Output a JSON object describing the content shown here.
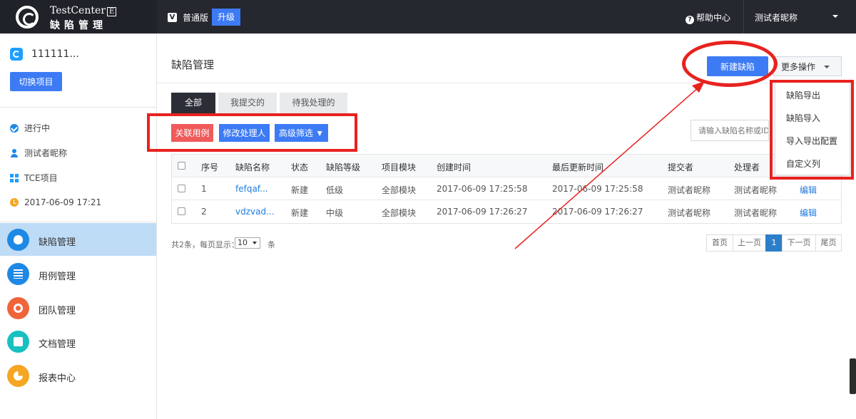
{
  "brand": {
    "line1": "TestCenter",
    "badge": "E",
    "line2": "缺陷管理"
  },
  "topbar": {
    "edition_icon": "V",
    "edition": "普通版",
    "upgrade": "升级",
    "help_icon": "?",
    "help": "帮助中心",
    "user": "测试者昵称"
  },
  "sidebar": {
    "project_name": "111111...",
    "switch_button": "切换项目",
    "info": [
      {
        "icon": "check-circle-icon",
        "text": "进行中"
      },
      {
        "icon": "user-icon",
        "text": "测试者昵称"
      },
      {
        "icon": "grid-icon",
        "text": "TCE项目"
      },
      {
        "icon": "clock-icon",
        "text": "2017-06-09 17:21"
      }
    ],
    "nav": [
      {
        "icon": "bug-icon",
        "label": "缺陷管理",
        "color": "#1e88e5",
        "active": true
      },
      {
        "icon": "list-icon",
        "label": "用例管理",
        "color": "#1e88e5",
        "active": false
      },
      {
        "icon": "team-icon",
        "label": "团队管理",
        "color": "#f0643c",
        "active": false
      },
      {
        "icon": "document-icon",
        "label": "文档管理",
        "color": "#18c0c0",
        "active": false
      },
      {
        "icon": "pie-chart-icon",
        "label": "报表中心",
        "color": "#f5a623",
        "active": false
      }
    ]
  },
  "main": {
    "title": "缺陷管理",
    "new_button": "新建缺陷",
    "more_button": "更多操作",
    "tabs": [
      "全部",
      "我提交的",
      "待我处理的"
    ],
    "actions": {
      "link_case": "关联用例",
      "change_handler": "修改处理人",
      "advanced_filter": "高级筛选 ▼"
    },
    "search_placeholder": "请输入缺陷名称或ID",
    "dropdown": [
      "缺陷导出",
      "缺陷导入",
      "导入导出配置",
      "自定义列"
    ],
    "table": {
      "headers": [
        "序号",
        "缺陷名称",
        "状态",
        "缺陷等级",
        "项目模块",
        "创建时间",
        "最后更新时间",
        "提交者",
        "处理者"
      ],
      "rows": [
        {
          "no": "1",
          "name": "fefqaf...",
          "status": "新建",
          "level": "低级",
          "module": "全部模块",
          "created": "2017-06-09 17:25:58",
          "updated": "2017-06-09 17:25:58",
          "submitter": "测试者昵称",
          "handler": "测试者昵称",
          "op": "编辑"
        },
        {
          "no": "2",
          "name": "vdzvad...",
          "status": "新建",
          "level": "中级",
          "module": "全部模块",
          "created": "2017-06-09 17:26:27",
          "updated": "2017-06-09 17:26:27",
          "submitter": "测试者昵称",
          "handler": "测试者昵称",
          "op": "编辑"
        }
      ]
    },
    "footer": {
      "total": "共2条，每页显示：",
      "page_size": "10",
      "unit": "条",
      "pager": [
        "首页",
        "上一页",
        "1",
        "下一页",
        "尾页"
      ],
      "current_page": "1"
    }
  },
  "annotation_color": "#e8221f"
}
